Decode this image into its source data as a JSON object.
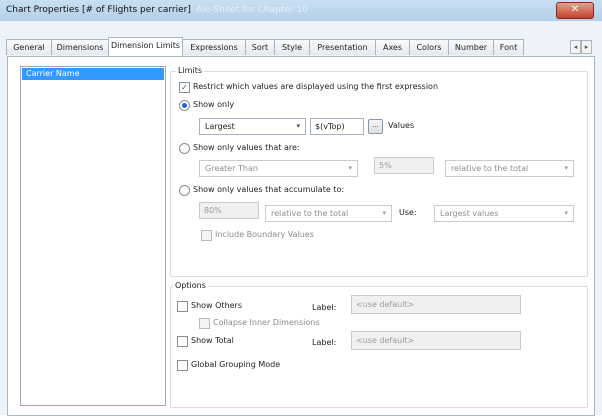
{
  "window": {
    "title": "Chart Properties [# of Flights per carrier]",
    "ghost_title": "Ale-Sheet for Chapter 10",
    "close_label": "✕"
  },
  "tabs": [
    {
      "label": "General",
      "active": false
    },
    {
      "label": "Dimensions",
      "active": false
    },
    {
      "label": "Dimension Limits",
      "active": true
    },
    {
      "label": "Expressions",
      "active": false
    },
    {
      "label": "Sort",
      "active": false
    },
    {
      "label": "Style",
      "active": false
    },
    {
      "label": "Presentation",
      "active": false
    },
    {
      "label": "Axes",
      "active": false
    },
    {
      "label": "Colors",
      "active": false
    },
    {
      "label": "Number",
      "active": false
    },
    {
      "label": "Font",
      "active": false
    }
  ],
  "tab_scroll": {
    "left": "◂",
    "right": "▸"
  },
  "dimensions_list": {
    "items": [
      "Carrier Name"
    ],
    "selected": "Carrier Name"
  },
  "limits": {
    "group_label": "Limits",
    "restrict_label": "Restrict which values are displayed using the first expression",
    "restrict_checked": true,
    "show_only": {
      "label": "Show only",
      "selected": true,
      "combo_value": "Largest",
      "count_value": "$(vTop)",
      "button_label": "...",
      "values_label": "Values"
    },
    "show_only_are": {
      "label": "Show only values that are:",
      "selected": false,
      "operator_value": "Greater Than",
      "percent_value": "5%",
      "relative_value": "relative to the total"
    },
    "accumulate": {
      "label": "Show only values that accumulate to:",
      "selected": false,
      "percent_value": "80%",
      "relative_value": "relative to the total",
      "use_label": "Use:",
      "use_value": "Largest values"
    },
    "include_boundary_label": "Include Boundary Values"
  },
  "options": {
    "group_label": "Options",
    "show_others_label": "Show Others",
    "others_label_caption": "Label:",
    "others_label_placeholder": "<use default>",
    "collapse_inner_label": "Collapse Inner Dimensions",
    "show_total_label": "Show Total",
    "total_label_caption": "Label:",
    "total_label_placeholder": "<use default>",
    "global_grouping_label": "Global Grouping Mode"
  },
  "icons": {
    "check": "✓",
    "dropdown": "▾"
  },
  "colors": {
    "selection": "#3399ff",
    "titlebar": "#b3cfe9",
    "close": "#c2422a"
  }
}
